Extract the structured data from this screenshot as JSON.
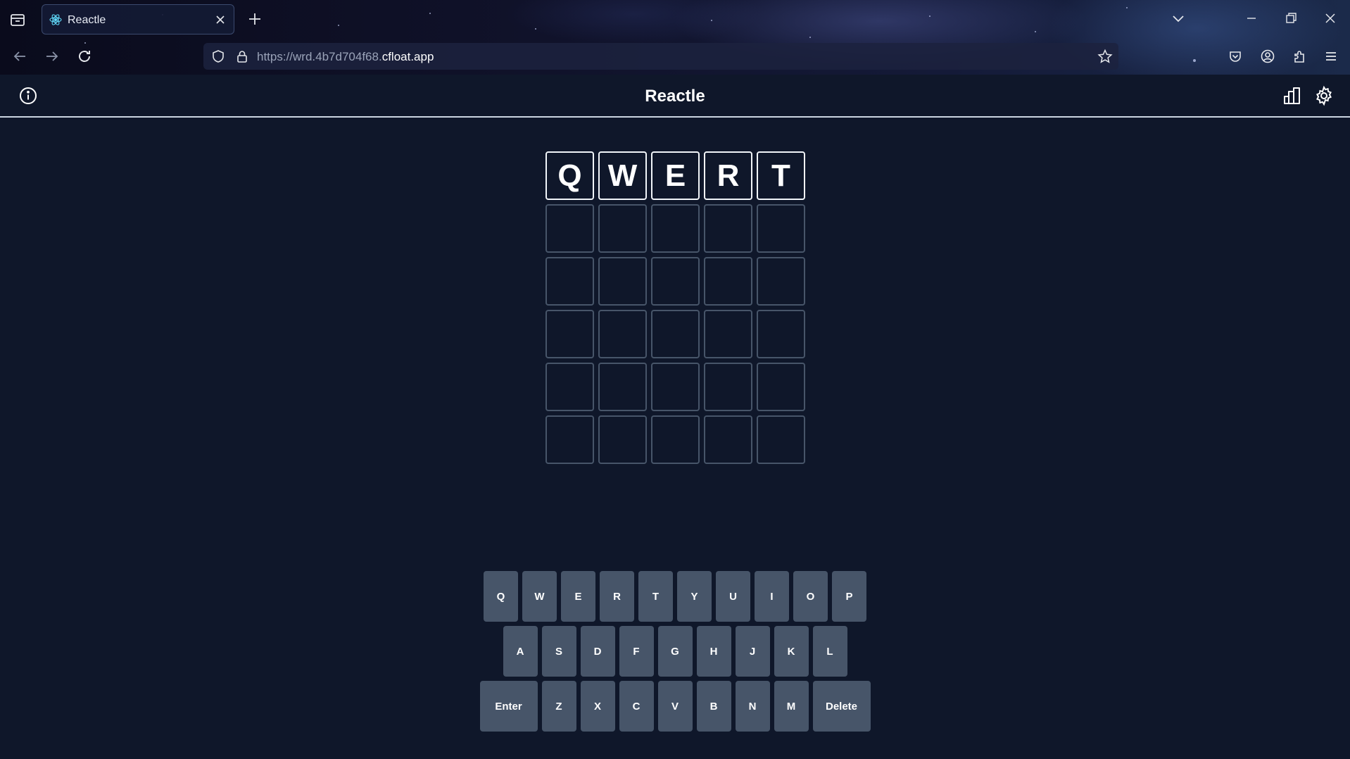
{
  "browser": {
    "tab": {
      "title": "Reactle",
      "favicon": "react-icon"
    },
    "url": {
      "prefix": "https://wrd.4b7d704f68.",
      "domain": "cfloat.app"
    }
  },
  "app": {
    "title": "Reactle",
    "grid": [
      [
        "Q",
        "W",
        "E",
        "R",
        "T"
      ],
      [
        "",
        "",
        "",
        "",
        ""
      ],
      [
        "",
        "",
        "",
        "",
        ""
      ],
      [
        "",
        "",
        "",
        "",
        ""
      ],
      [
        "",
        "",
        "",
        "",
        ""
      ],
      [
        "",
        "",
        "",
        "",
        ""
      ]
    ],
    "keyboard": {
      "row1": [
        "Q",
        "W",
        "E",
        "R",
        "T",
        "Y",
        "U",
        "I",
        "O",
        "P"
      ],
      "row2": [
        "A",
        "S",
        "D",
        "F",
        "G",
        "H",
        "J",
        "K",
        "L"
      ],
      "row3": [
        "Enter",
        "Z",
        "X",
        "C",
        "V",
        "B",
        "N",
        "M",
        "Delete"
      ]
    }
  },
  "colors": {
    "background": "#0f172a",
    "tile_border_empty": "#475569",
    "tile_border_filled": "#f1f5f9",
    "key_background": "#475569"
  }
}
